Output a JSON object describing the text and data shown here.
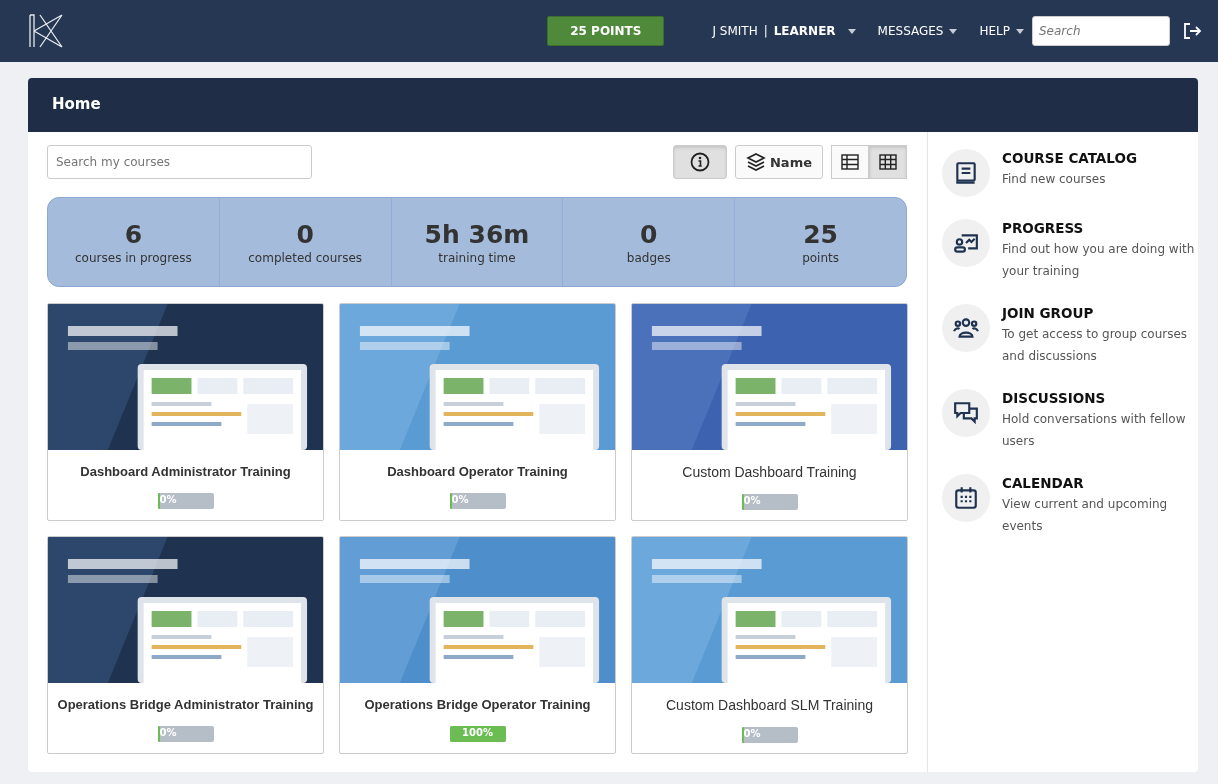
{
  "header": {
    "points": "25 POINTS",
    "user": "J SMITH",
    "separator": "|",
    "role": "LEARNER",
    "menus": [
      "MESSAGES",
      "HELP"
    ],
    "search": {
      "placeholder": "Search"
    }
  },
  "panel": {
    "title": "Home"
  },
  "toolbar": {
    "search": {
      "placeholder": "Search my courses"
    },
    "info": {
      "selected": true
    },
    "sort": {
      "label": "Name"
    },
    "views": [
      {
        "kind": "list",
        "selected": false
      },
      {
        "kind": "grid",
        "selected": true
      }
    ]
  },
  "stats": [
    {
      "value": "6",
      "label": "courses in progress"
    },
    {
      "value": "0",
      "label": "completed courses"
    },
    {
      "value": "5h 36m",
      "label": "training time"
    },
    {
      "value": "0",
      "label": "badges"
    },
    {
      "value": "25",
      "label": "points"
    }
  ],
  "courses": [
    {
      "title": "Dashboard Administrator Training",
      "bold": true,
      "level": 0.04,
      "progress": "0%"
    },
    {
      "title": "Dashboard Operator Training",
      "bold": true,
      "level": 0.04,
      "progress": "0%"
    },
    {
      "title": "Custom Dashboard Training",
      "bold": false,
      "level": 0.04,
      "progress": "0%"
    },
    {
      "title": "Operations Bridge Administrator Training",
      "bold": true,
      "level": 0.04,
      "progress": "0%"
    },
    {
      "title": "Operations Bridge Operator Training",
      "bold": true,
      "level": 1,
      "progress": "100%"
    },
    {
      "title": "Custom Dashboard SLM  Training",
      "bold": false,
      "level": 0.04,
      "progress": "0%"
    }
  ],
  "sidebar": {
    "items": [
      {
        "kind": "catalog",
        "title": "COURSE CATALOG",
        "description": "Find new courses"
      },
      {
        "kind": "progress",
        "title": "PROGRESS",
        "description": "Find out how you are doing with your training"
      },
      {
        "kind": "group",
        "title": "JOIN GROUP",
        "description": "To get access to group courses and discussions"
      },
      {
        "kind": "discussions",
        "title": "DISCUSSIONS",
        "description": "Hold conversations with fellow users"
      },
      {
        "kind": "calendar",
        "title": "CALENDAR",
        "description": "View current and upcoming events"
      }
    ]
  }
}
